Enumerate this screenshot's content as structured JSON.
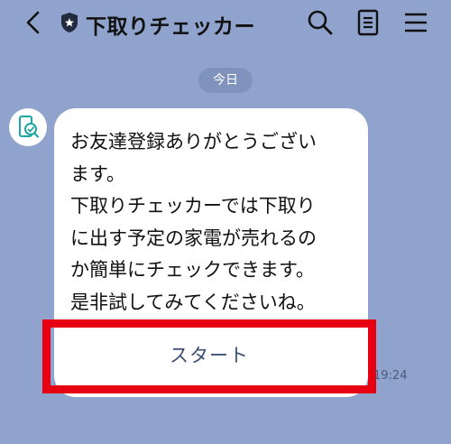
{
  "header": {
    "title": "下取りチェッカー"
  },
  "chat": {
    "date_label": "今日",
    "message_lines": [
      "お友達登録ありがとうござい",
      "ます。",
      "下取りチェッカーでは下取り",
      "に出す予定の家電が売れるの",
      "か簡単にチェックできます。",
      "是非試してみてくださいね。"
    ],
    "button_label": "スタート",
    "timestamp": "19:24"
  },
  "colors": {
    "background": "#8fa3cd",
    "highlight": "#e60012",
    "button_text": "#3c5073",
    "avatar_accent": "#1ba6a3"
  }
}
